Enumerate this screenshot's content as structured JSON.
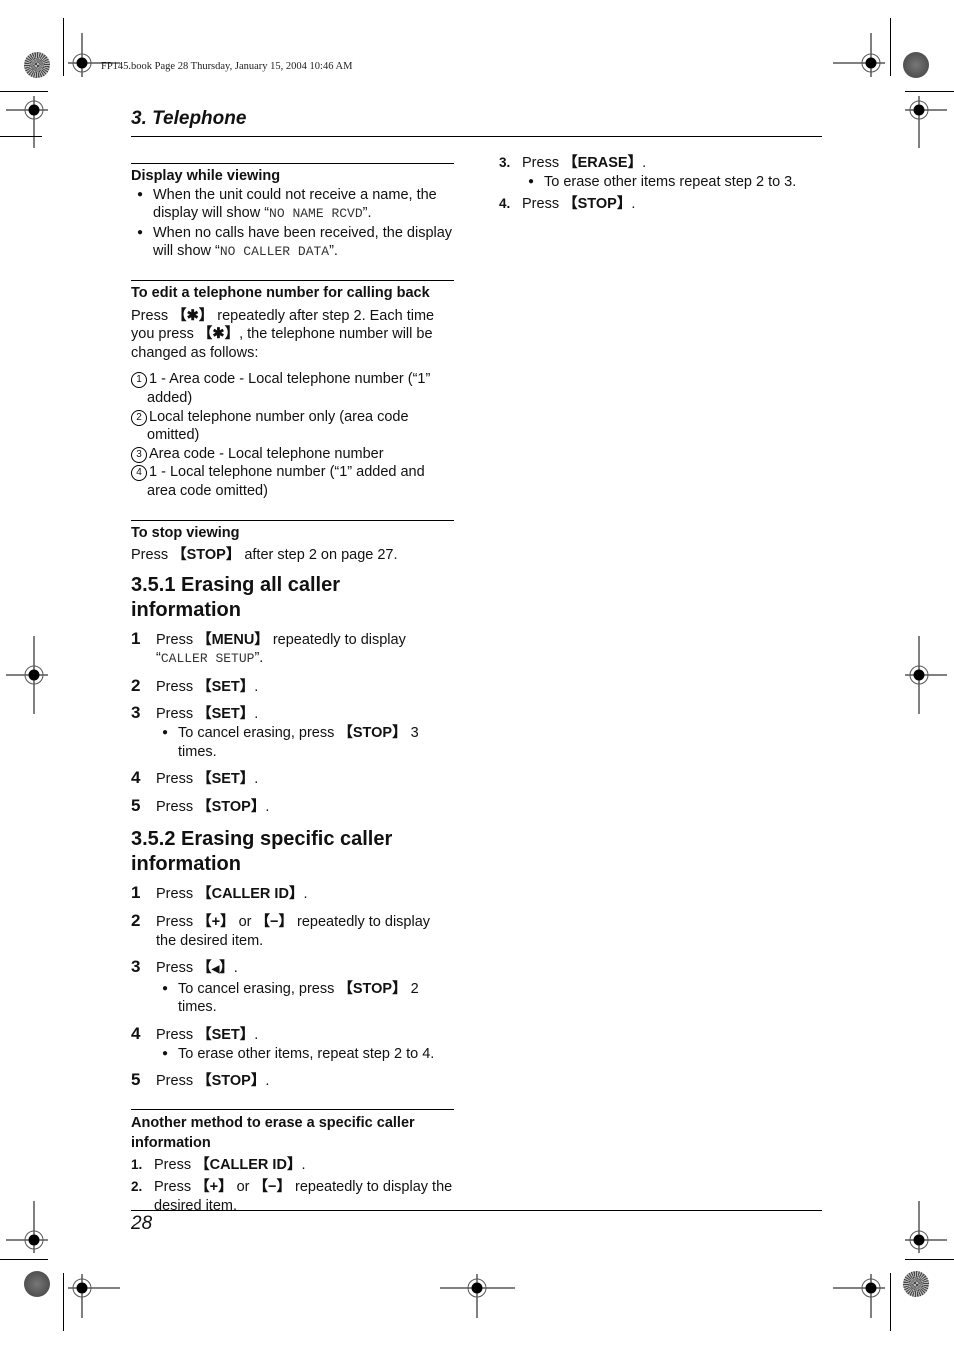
{
  "book_meta": "FP145.book  Page 28  Thursday, January 15, 2004  10:46 AM",
  "chapter_title": "3. Telephone",
  "page_number": "28",
  "display_while_viewing": {
    "heading": "Display while viewing",
    "bullets": [
      {
        "pre": "When the unit could not receive a name, the display will show “",
        "code": "NO NAME RCVD",
        "post": "”."
      },
      {
        "pre": "When no calls have been received, the display will show “",
        "code": "NO CALLER DATA",
        "post": "”."
      }
    ]
  },
  "edit_number": {
    "heading": "To edit a telephone number for calling back",
    "p1": "Press ",
    "key1": "✱",
    "p2": " repeatedly after step 2. Each time you press ",
    "key2": "✱",
    "p3": ", the telephone number will be changed as follows:",
    "options": [
      {
        "num": "1",
        "text": "1 - Area code - Local telephone number (“1” added)"
      },
      {
        "num": "2",
        "text": "Local telephone number only (area code omitted)"
      },
      {
        "num": "3",
        "text": "Area code - Local telephone number"
      },
      {
        "num": "4",
        "text": "1 - Local telephone number (“1” added and area code omitted)"
      }
    ]
  },
  "stop_viewing": {
    "heading": "To stop viewing",
    "pre": "Press ",
    "key": "STOP",
    "post": " after step 2 on page 27."
  },
  "section_351": {
    "title": "3.5.1 Erasing all caller information",
    "steps": [
      {
        "num": "1",
        "pre": "Press ",
        "key": "MENU",
        "post": " repeatedly to display",
        "code": "CALLER SETUP"
      },
      {
        "num": "2",
        "pre": "Press ",
        "key": "SET",
        "post": "."
      },
      {
        "num": "3",
        "pre": "Press ",
        "key": "SET",
        "post": ".",
        "note_pre": "To cancel erasing, press ",
        "note_key": "STOP",
        "note_post": " 3 times."
      },
      {
        "num": "4",
        "pre": "Press ",
        "key": "SET",
        "post": "."
      },
      {
        "num": "5",
        "pre": "Press ",
        "key": "STOP",
        "post": "."
      }
    ]
  },
  "section_352": {
    "title": "3.5.2 Erasing specific caller information",
    "steps": [
      {
        "num": "1",
        "pre": "Press ",
        "key": "CALLER ID",
        "post": "."
      },
      {
        "num": "2",
        "pre": "Press ",
        "key": "+",
        "mid": " or ",
        "key2": "−",
        "post": " repeatedly to display the desired item."
      },
      {
        "num": "3",
        "pre": "Press ",
        "key": "◀",
        "post": ".",
        "note_pre": "To cancel erasing, press ",
        "note_key": "STOP",
        "note_post": " 2 times."
      },
      {
        "num": "4",
        "pre": "Press ",
        "key": "SET",
        "post": ".",
        "note": "To erase other items, repeat step 2 to 4."
      },
      {
        "num": "5",
        "pre": "Press ",
        "key": "STOP",
        "post": "."
      }
    ]
  },
  "another_method": {
    "heading": "Another method to erase a specific caller information",
    "steps": [
      {
        "num": "1.",
        "pre": "Press ",
        "key": "CALLER ID",
        "post": "."
      },
      {
        "num": "2.",
        "pre": "Press ",
        "key": "+",
        "mid": " or ",
        "key2": "−",
        "post": " repeatedly to display the desired item."
      },
      {
        "num": "3.",
        "pre": "Press ",
        "key": "ERASE",
        "post": ".",
        "note": "To erase other items repeat step 2 to 3."
      },
      {
        "num": "4.",
        "pre": "Press ",
        "key": "STOP",
        "post": "."
      }
    ]
  },
  "brackets": {
    "open": "【",
    "close": "】"
  }
}
